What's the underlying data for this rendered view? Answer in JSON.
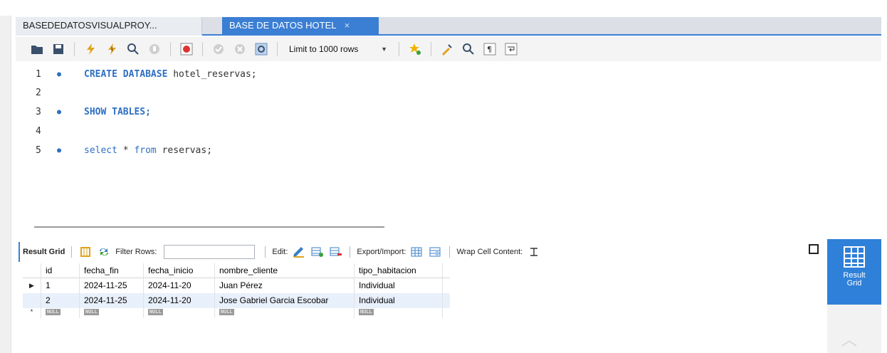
{
  "tabs": [
    {
      "label": "BASEDEDATOSVISUALPROY...",
      "active": false
    },
    {
      "label": "BASE DE DATOS HOTEL",
      "active": true,
      "close": "×"
    }
  ],
  "toolbar": {
    "icons": [
      "folder-icon",
      "save-icon",
      "execute-icon",
      "execute-current-icon",
      "explain-icon",
      "stop-icon",
      "toggle-error-icon",
      "commit-icon",
      "rollback-icon",
      "autocommit-icon"
    ],
    "limit_label": "Limit to 1000 rows",
    "right_icons": [
      "add-snippet-icon",
      "beautify-icon",
      "find-icon",
      "invisible-chars-icon",
      "wrap-icon"
    ]
  },
  "editor": {
    "lines": [
      {
        "num": "1",
        "dot": "●",
        "parts": [
          {
            "t": "CREATE DATABASE ",
            "k": "kw"
          },
          {
            "t": "hotel_reservas;",
            "k": "id"
          }
        ]
      },
      {
        "num": "2",
        "dot": "",
        "parts": []
      },
      {
        "num": "3",
        "dot": "●",
        "parts": [
          {
            "t": "SHOW TABLES;",
            "k": "kw"
          }
        ]
      },
      {
        "num": "4",
        "dot": "",
        "parts": []
      },
      {
        "num": "5",
        "dot": "●",
        "parts": [
          {
            "t": "select ",
            "k": "kw2"
          },
          {
            "t": "* ",
            "k": "id"
          },
          {
            "t": "from ",
            "k": "kw2"
          },
          {
            "t": "reservas;",
            "k": "id"
          }
        ]
      }
    ]
  },
  "result_toolbar": {
    "result_grid": "Result Grid",
    "filter_rows": "Filter Rows:",
    "edit": "Edit:",
    "export_import": "Export/Import:",
    "wrap_cell": "Wrap Cell Content:"
  },
  "side_panel": {
    "label_line1": "Result",
    "label_line2": "Grid"
  },
  "grid": {
    "columns": [
      "id",
      "fecha_fin",
      "fecha_inicio",
      "nombre_cliente",
      "tipo_habitacion"
    ],
    "rows": [
      {
        "marker": "▶",
        "cells": [
          "1",
          "2024-11-25",
          "2024-11-20",
          "Juan Pérez",
          "Individual"
        ]
      },
      {
        "marker": "",
        "cells": [
          "2",
          "2024-11-25",
          "2024-11-20",
          "Jose Gabriel Garcia Escobar",
          "Individual"
        ]
      }
    ],
    "null_row": {
      "marker": "*",
      "value": "NULL"
    }
  },
  "colors": {
    "accent": "#3b7fd4",
    "keyword": "#2f6fc4"
  }
}
